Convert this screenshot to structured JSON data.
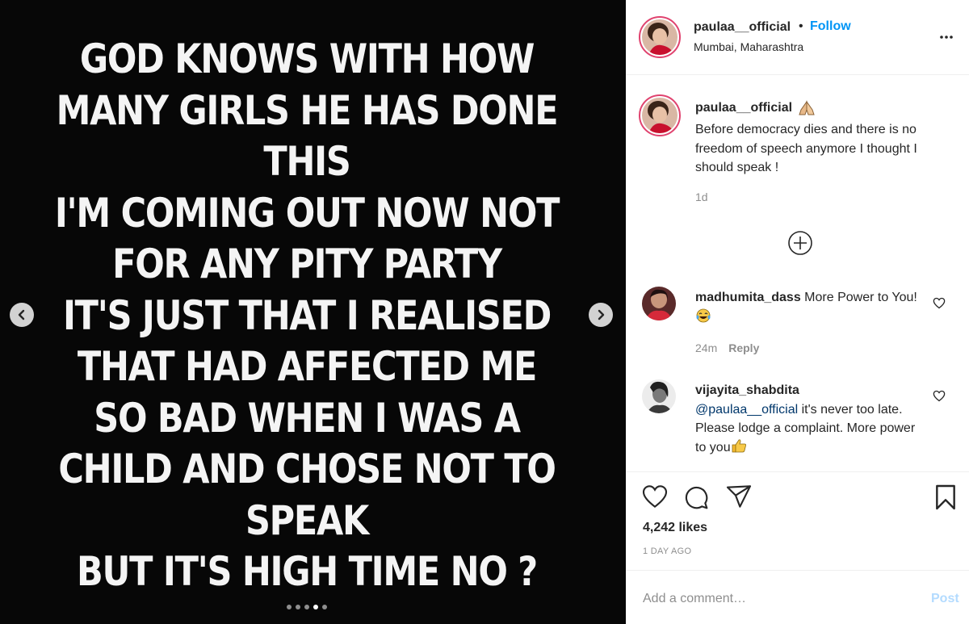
{
  "media": {
    "story_lines": [
      "GOD KNOWS WITH HOW",
      "MANY GIRLS HE HAS DONE",
      "THIS",
      "I'M COMING OUT NOW NOT",
      "FOR ANY PITY PARTY",
      "IT'S JUST THAT I REALISED",
      "THAT HAD AFFECTED ME",
      "SO BAD WHEN I WAS A",
      "CHILD AND CHOSE NOT TO",
      "SPEAK",
      "BUT IT'S HIGH TIME NO ?"
    ],
    "dots_count": 5,
    "active_dot": 4
  },
  "header": {
    "username": "paulaa__official",
    "separator": "•",
    "follow_label": "Follow",
    "location": "Mumbai, Maharashtra",
    "more_icon": "ellipsis-icon"
  },
  "caption": {
    "username": "paulaa__official",
    "emoji": "folded-hands-icon",
    "text": "Before democracy dies and there is no freedom of speech anymore I thought I should speak !",
    "time": "1d",
    "load_more_icon": "plus-circle-icon"
  },
  "comments": [
    {
      "username": "madhumita_dass",
      "text": "More Power to You!",
      "time": "24m",
      "reply_label": "Reply"
    },
    {
      "username": "vijayita_shabdita",
      "mention": "@paulaa__official",
      "text": "it's never too late. Please lodge a complaint. More power to you"
    }
  ],
  "actions": {
    "likes": "4,242 likes",
    "posted_ago": "1 DAY AGO"
  },
  "add_comment": {
    "placeholder": "Add a comment…",
    "post_label": "Post"
  },
  "colors": {
    "link_blue": "#0095f6",
    "post_disabled": "#b3dbff",
    "story_ring": "#e0436f",
    "media_bg": "#070707"
  }
}
